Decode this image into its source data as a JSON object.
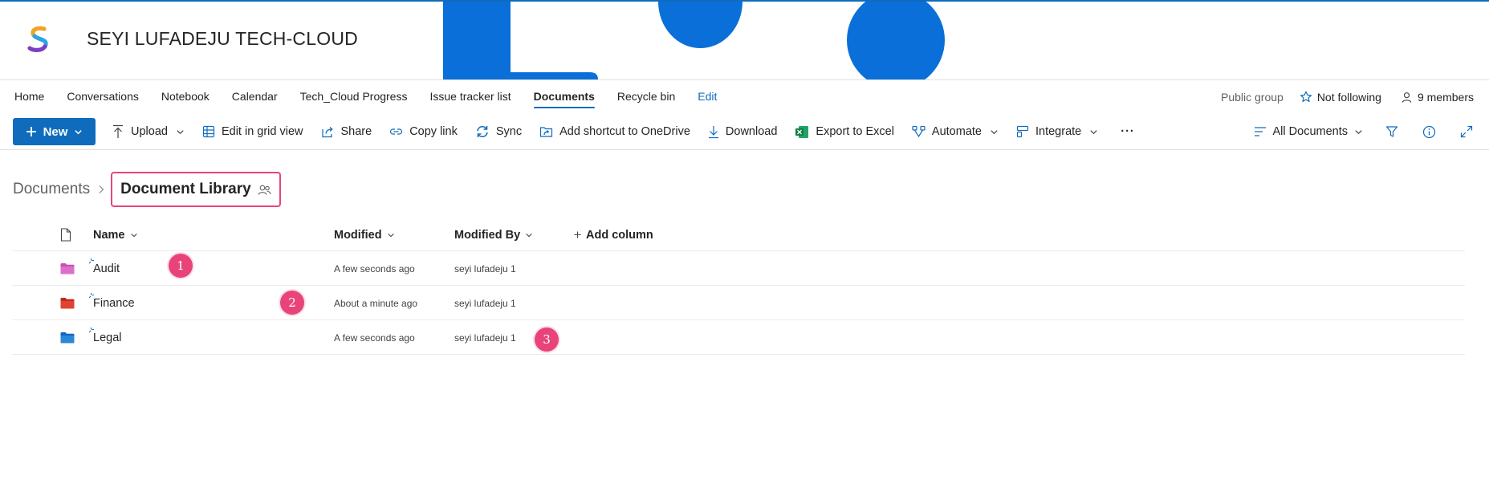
{
  "site": {
    "title": "SEYI LUFADEJU TECH-CLOUD"
  },
  "nav": {
    "items": [
      {
        "label": "Home"
      },
      {
        "label": "Conversations"
      },
      {
        "label": "Notebook"
      },
      {
        "label": "Calendar"
      },
      {
        "label": "Tech_Cloud Progress"
      },
      {
        "label": "Issue tracker list"
      },
      {
        "label": "Documents",
        "active": true
      },
      {
        "label": "Recycle bin"
      },
      {
        "label": "Edit"
      }
    ],
    "public_group": "Public group",
    "follow_label": "Not following",
    "members_label": "9 members"
  },
  "commands": {
    "new_label": "New",
    "upload": "Upload",
    "edit_grid": "Edit in grid view",
    "share": "Share",
    "copy_link": "Copy link",
    "sync": "Sync",
    "add_shortcut": "Add shortcut to OneDrive",
    "download": "Download",
    "export_excel": "Export to Excel",
    "automate": "Automate",
    "integrate": "Integrate",
    "more": "···",
    "view_label": "All Documents"
  },
  "breadcrumb": {
    "root": "Documents",
    "current": "Document Library"
  },
  "list": {
    "columns": {
      "name": "Name",
      "modified": "Modified",
      "modified_by": "Modified By",
      "add_column": "Add column"
    },
    "rows": [
      {
        "name": "Audit",
        "modified": "A few seconds ago",
        "modified_by": "seyi lufadeju 1",
        "folder_color": "#c84fb3"
      },
      {
        "name": "Finance",
        "modified": "About a minute ago",
        "modified_by": "seyi lufadeju 1",
        "folder_color": "#d83b2b"
      },
      {
        "name": "Legal",
        "modified": "A few seconds ago",
        "modified_by": "seyi lufadeju 1",
        "folder_color": "#1f7fd6"
      }
    ]
  },
  "markers": [
    {
      "label": "1"
    },
    {
      "label": "2"
    },
    {
      "label": "3"
    }
  ],
  "colors": {
    "accent": "#0f6cbd",
    "marker": "#e8447a",
    "banner": "#0a6fd8"
  }
}
